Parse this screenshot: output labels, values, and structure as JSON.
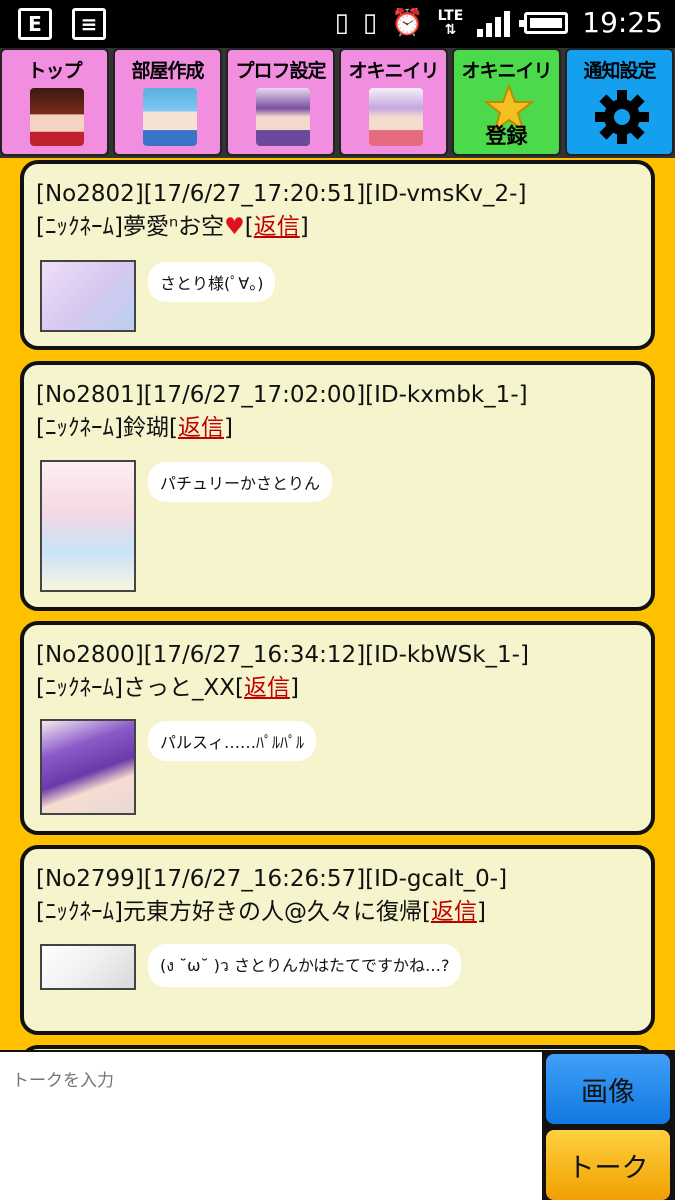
{
  "status_bar": {
    "left_icons": [
      "e-notification-icon",
      "news-icon"
    ],
    "right_icons": [
      "phone-vibrate-icon",
      "vibrate-icon",
      "alarm-icon"
    ],
    "network": "LTE",
    "time": "19:25"
  },
  "nav": {
    "tabs": [
      {
        "label": "トップ",
        "color": "#f28ee0"
      },
      {
        "label": "部屋作成",
        "color": "#f28ee0"
      },
      {
        "label": "プロフ設定",
        "color": "#f28ee0"
      },
      {
        "label": "オキニイリ",
        "color": "#f28ee0"
      },
      {
        "label": "オキニイリ",
        "sub": "登録",
        "color": "#4cd94c"
      },
      {
        "label": "通知設定",
        "color": "#14a0ee"
      }
    ]
  },
  "posts": [
    {
      "header": "[No2802][17/6/27_17:20:51][ID-vmsKv_2-]",
      "nick_prefix": "[ﾆｯｸﾈｰﾑ]",
      "nick": "夢愛ⁿお空",
      "heart": "♥",
      "reply_open": "[",
      "reply": "返信",
      "reply_close": "]",
      "message": "さとり様(ﾟ∀。)"
    },
    {
      "header": "[No2801][17/6/27_17:02:00][ID-kxmbk_1-]",
      "nick_prefix": "[ﾆｯｸﾈｰﾑ]",
      "nick": "鈴瑚",
      "reply_open": "[",
      "reply": "返信",
      "reply_close": "]",
      "message": "パチュリーかさとりん"
    },
    {
      "header": "[No2800][17/6/27_16:34:12][ID-kbWSk_1-]",
      "nick_prefix": "[ﾆｯｸﾈｰﾑ]",
      "nick": "さっと_XX",
      "reply_open": "[",
      "reply": "返信",
      "reply_close": "]",
      "message": "パルスィ……ﾊﾟﾙﾊﾟﾙ"
    },
    {
      "header": "[No2799][17/6/27_16:26:57][ID-gcalt_0-]",
      "nick_prefix": "[ﾆｯｸﾈｰﾑ]",
      "nick": "元東方好きの人@久々に復帰",
      "reply_open": "[",
      "reply": "返信",
      "reply_close": "]",
      "message": "(ง ˘ω˘ )ว さとりんかはたてですかね…?"
    }
  ],
  "composer": {
    "placeholder": "トークを入力",
    "image_button": "画像",
    "talk_button": "トーク"
  },
  "colors": {
    "background": "#ffc000",
    "card": "#f5f4cd",
    "reply_link": "#c00000"
  }
}
